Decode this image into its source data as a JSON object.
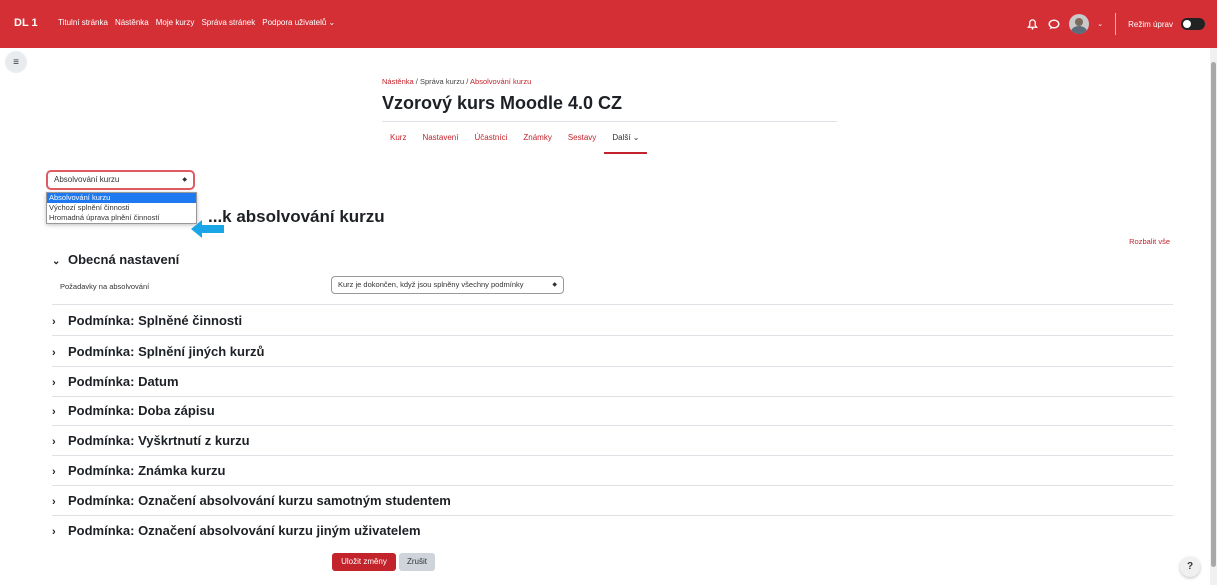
{
  "navbar": {
    "brand": "DL 1",
    "items": [
      "Titulní stránka",
      "Nástěnka",
      "Moje kurzy",
      "Správa stránek",
      "Podpora uživatelů ⌄"
    ],
    "edit_mode_label": "Režim úprav",
    "bg_color": "#d32f35"
  },
  "breadcrumb": {
    "item1": "Nástěnka",
    "item2": "Správa kurzu",
    "item3": "Absolvování kurzu",
    "sep": "/"
  },
  "course_title": "Vzorový kurs Moodle 4.0 CZ",
  "tabs": [
    "Kurz",
    "Nastavení",
    "Účastníci",
    "Známky",
    "Sestavy",
    "Další ⌄"
  ],
  "selector": {
    "value": "Absolvování kurzu",
    "options": [
      "Absolvování kurzu",
      "Výchozí splnění činnosti",
      "Hromadná úprava plnění činností"
    ]
  },
  "page_heading": "...k absolvování kurzu",
  "expand_all": "Rozbalit vše",
  "general": {
    "title": "Obecná nastavení",
    "req_label": "Požadavky na absolvování",
    "req_value": "Kurz je dokončen, když jsou splněny všechny podmínky"
  },
  "conditions": [
    "Podmínka: Splněné činnosti",
    "Podmínka: Splnění jiných kurzů",
    "Podmínka: Datum",
    "Podmínka: Doba zápisu",
    "Podmínka: Vyškrtnutí z kurzu",
    "Podmínka: Známka kurzu",
    "Podmínka: Označení absolvování kurzu samotným studentem",
    "Podmínka: Označení absolvování kurzu jiným uživatelem"
  ],
  "buttons": {
    "save": "Uložit změny",
    "cancel": "Zrušit"
  },
  "help_label": "?",
  "accent": "#c3232b"
}
